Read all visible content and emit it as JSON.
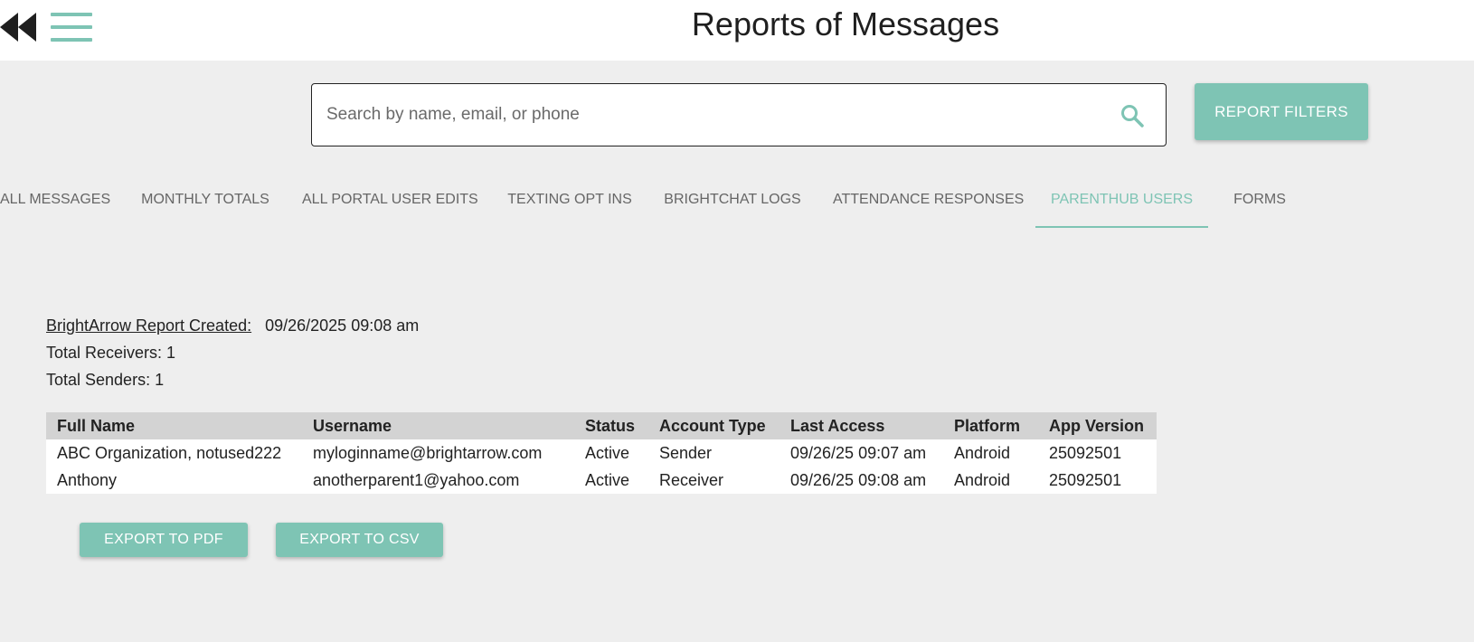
{
  "header": {
    "title": "Reports of Messages",
    "back_icon": "rewind-icon",
    "menu_icon": "hamburger-menu-icon"
  },
  "search": {
    "placeholder": "Search by name, email, or phone",
    "value": "",
    "icon": "search-icon"
  },
  "buttons": {
    "report_filters": "REPORT FILTERS",
    "export_pdf": "EXPORT TO PDF",
    "export_csv": "EXPORT TO CSV"
  },
  "tabs": [
    {
      "label": "ALL MESSAGES",
      "active": false
    },
    {
      "label": "MONTHLY TOTALS",
      "active": false
    },
    {
      "label": "ALL PORTAL USER EDITS",
      "active": false
    },
    {
      "label": "TEXTING OPT INS",
      "active": false
    },
    {
      "label": "BRIGHTCHAT LOGS",
      "active": false
    },
    {
      "label": "ATTENDANCE RESPONSES",
      "active": false
    },
    {
      "label": "PARENTHUB USERS",
      "active": true
    },
    {
      "label": "FORMS",
      "active": false
    }
  ],
  "report": {
    "created_label": "BrightArrow Report Created:",
    "created_value": "09/26/2025 09:08 am",
    "total_receivers": "Total Receivers: 1",
    "total_senders": "Total Senders: 1"
  },
  "table": {
    "headers": [
      "Full Name",
      "Username",
      "Status",
      "Account Type",
      "Last Access",
      "Platform",
      "App Version"
    ],
    "rows": [
      [
        "ABC Organization, notused222",
        "myloginname@brightarrow.com",
        "Active",
        "Sender",
        "09/26/25 09:07 am",
        "Android",
        "25092501"
      ],
      [
        "Anthony",
        "anotherparent1@yahoo.com",
        "Active",
        "Receiver",
        "09/26/25 09:08 am",
        "Android",
        "25092501"
      ]
    ]
  },
  "colors": {
    "accent": "#7ec4b4",
    "background": "#eeeeee",
    "header_row": "#d3d3d3",
    "text": "#222222"
  }
}
